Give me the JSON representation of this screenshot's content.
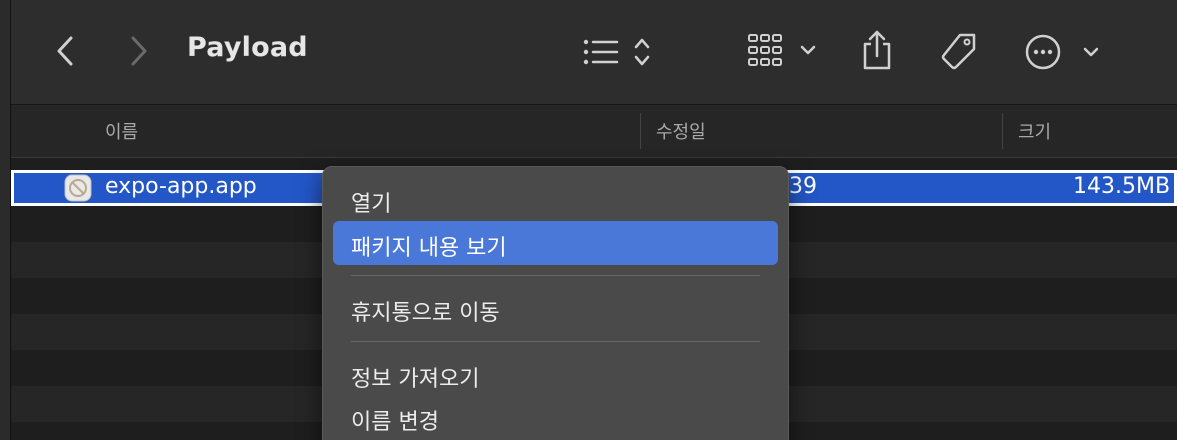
{
  "window": {
    "title": "Payload"
  },
  "toolbar": {
    "back_icon": "chevron-left-icon",
    "forward_icon": "chevron-right-icon",
    "view_options_icon": "list-sort-icon",
    "group_icon": "grid-group-icon",
    "share_icon": "share-icon",
    "tag_icon": "tag-icon",
    "more_icon": "ellipsis-circle-icon"
  },
  "columns": [
    {
      "label": "이름"
    },
    {
      "label": "수정일"
    },
    {
      "label": "크기"
    }
  ],
  "files": [
    {
      "name": "expo-app.app",
      "modified_visible": "39",
      "size": "143.5MB",
      "selected": true
    }
  ],
  "context_menu": {
    "items": [
      {
        "label": "열기"
      },
      {
        "label": "패키지 내용 보기",
        "highlighted": true
      },
      {
        "label": "휴지통으로 이동"
      },
      {
        "label": "정보 가져오기"
      },
      {
        "label": "이름 변경"
      }
    ]
  },
  "colors": {
    "selection": "#2357c7",
    "menu_highlight": "#4a78d9",
    "toolbar_bg": "#2d2d2d",
    "menu_bg": "#4a4a4a"
  }
}
